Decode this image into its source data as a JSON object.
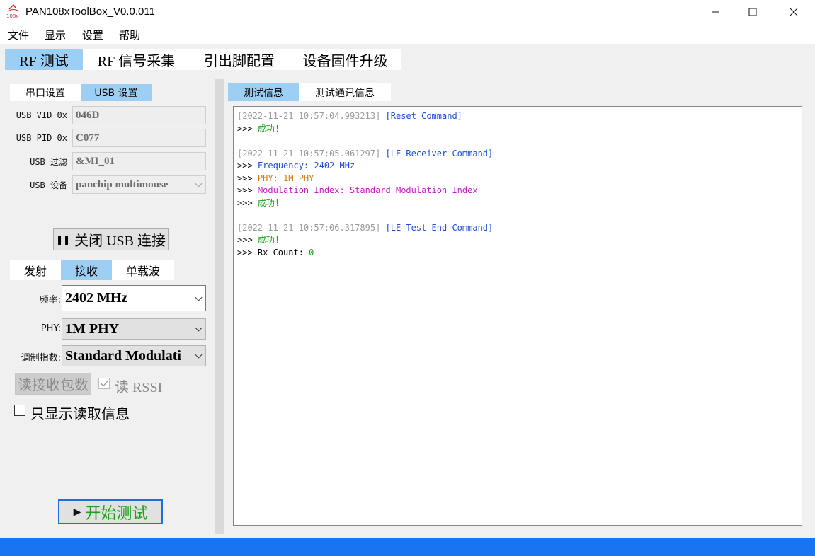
{
  "window": {
    "title": "PAN108xToolBox_V0.0.011",
    "logo_text": "108x"
  },
  "menu": [
    "文件",
    "显示",
    "设置",
    "帮助"
  ],
  "main_tabs": [
    {
      "label": "RF 测试",
      "active": true
    },
    {
      "label": "RF 信号采集",
      "active": false
    },
    {
      "label": "引出脚配置",
      "active": false
    },
    {
      "label": "设备固件升级",
      "active": false
    }
  ],
  "connection_tabs": [
    {
      "label": "串口设置",
      "active": false
    },
    {
      "label": "USB 设置",
      "active": true
    }
  ],
  "usb": {
    "vid_label": "USB VID 0x",
    "vid_value": "046D",
    "pid_label": "USB PID 0x",
    "pid_value": "C077",
    "filter_label": "USB 过滤",
    "filter_value": "&MI_01",
    "device_label": "USB 设备",
    "device_value": "panchip multimouse"
  },
  "close_usb_button": "关闭 USB 连接",
  "mode_tabs": [
    {
      "label": "发射",
      "active": false
    },
    {
      "label": "接收",
      "active": true
    },
    {
      "label": "单载波",
      "active": false
    }
  ],
  "rx": {
    "freq_label": "频率:",
    "freq_value": "2402 MHz",
    "phy_label": "PHY:",
    "phy_value": "1M PHY",
    "mod_label": "调制指数:",
    "mod_value": "Standard Modulati"
  },
  "read_count_button": "读接收包数",
  "read_rssi_label": "读 RSSI",
  "read_rssi_checked": true,
  "only_read_label": "只显示读取信息",
  "only_read_checked": false,
  "start_button": "开始测试",
  "log_tabs": [
    {
      "label": "测试信息",
      "active": true
    },
    {
      "label": "测试通讯信息",
      "active": false
    }
  ],
  "log": {
    "entries": [
      {
        "time": "[2022-11-21 10:57:04.993213]",
        "command": "[Reset Command]",
        "lines": [
          {
            "prefix": ">>> ",
            "text": "成功!",
            "kind": "ok"
          }
        ]
      },
      {
        "time": "[2022-11-21 10:57:05.061297]",
        "command": "[LE Receiver Command]",
        "lines": [
          {
            "prefix": ">>> ",
            "text": "Frequency: 2402 MHz",
            "kind": "freq"
          },
          {
            "prefix": ">>> ",
            "text": "PHY: 1M PHY",
            "kind": "phy"
          },
          {
            "prefix": ">>> ",
            "text": "Modulation Index: Standard Modulation Index",
            "kind": "mod"
          },
          {
            "prefix": ">>> ",
            "text": "成功!",
            "kind": "ok"
          }
        ]
      },
      {
        "time": "[2022-11-21 10:57:06.317895]",
        "command": "[LE Test End Command]",
        "lines": [
          {
            "prefix": ">>> ",
            "text": "成功!",
            "kind": "ok"
          },
          {
            "prefix": ">>> ",
            "label": "Rx Count: ",
            "text": "0",
            "kind": "count"
          }
        ]
      }
    ]
  },
  "colors": {
    "tab_active": "#9ccff3",
    "status_bar": "#1874f0",
    "start_text": "#1aa31a",
    "start_border": "#1e6fd8"
  }
}
